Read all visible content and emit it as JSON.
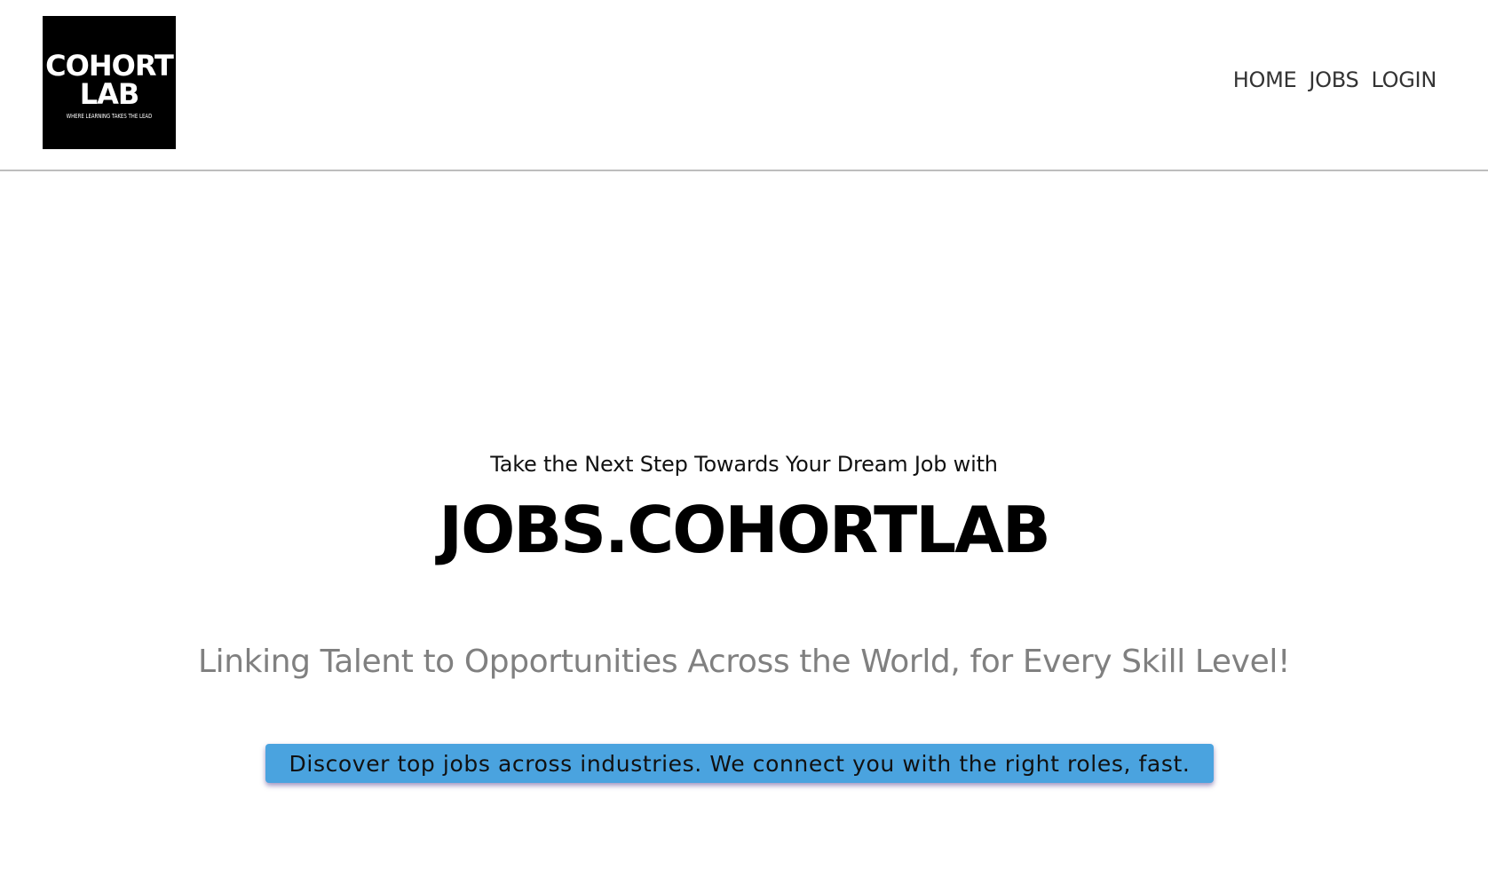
{
  "header": {
    "logo": {
      "line1": "COHORT",
      "line2": "LAB",
      "tagline": "WHERE LEARNING TAKES THE LEAD"
    },
    "nav": [
      {
        "label": "HOME"
      },
      {
        "label": "JOBS"
      },
      {
        "label": "LOGIN"
      }
    ]
  },
  "hero": {
    "kicker": "Take the Next Step Towards Your Dream Job with",
    "title": "JOBS.COHORTLAB",
    "subtitle": "Linking Talent to Opportunities Across the World, for Every Skill Level!",
    "callout": "Discover top jobs across industries. We connect you with the right roles, fast."
  },
  "colors": {
    "logo_background": "#000000",
    "callout_background": "#4aa3df",
    "subtitle_text": "#808080",
    "nav_text": "#333333"
  }
}
